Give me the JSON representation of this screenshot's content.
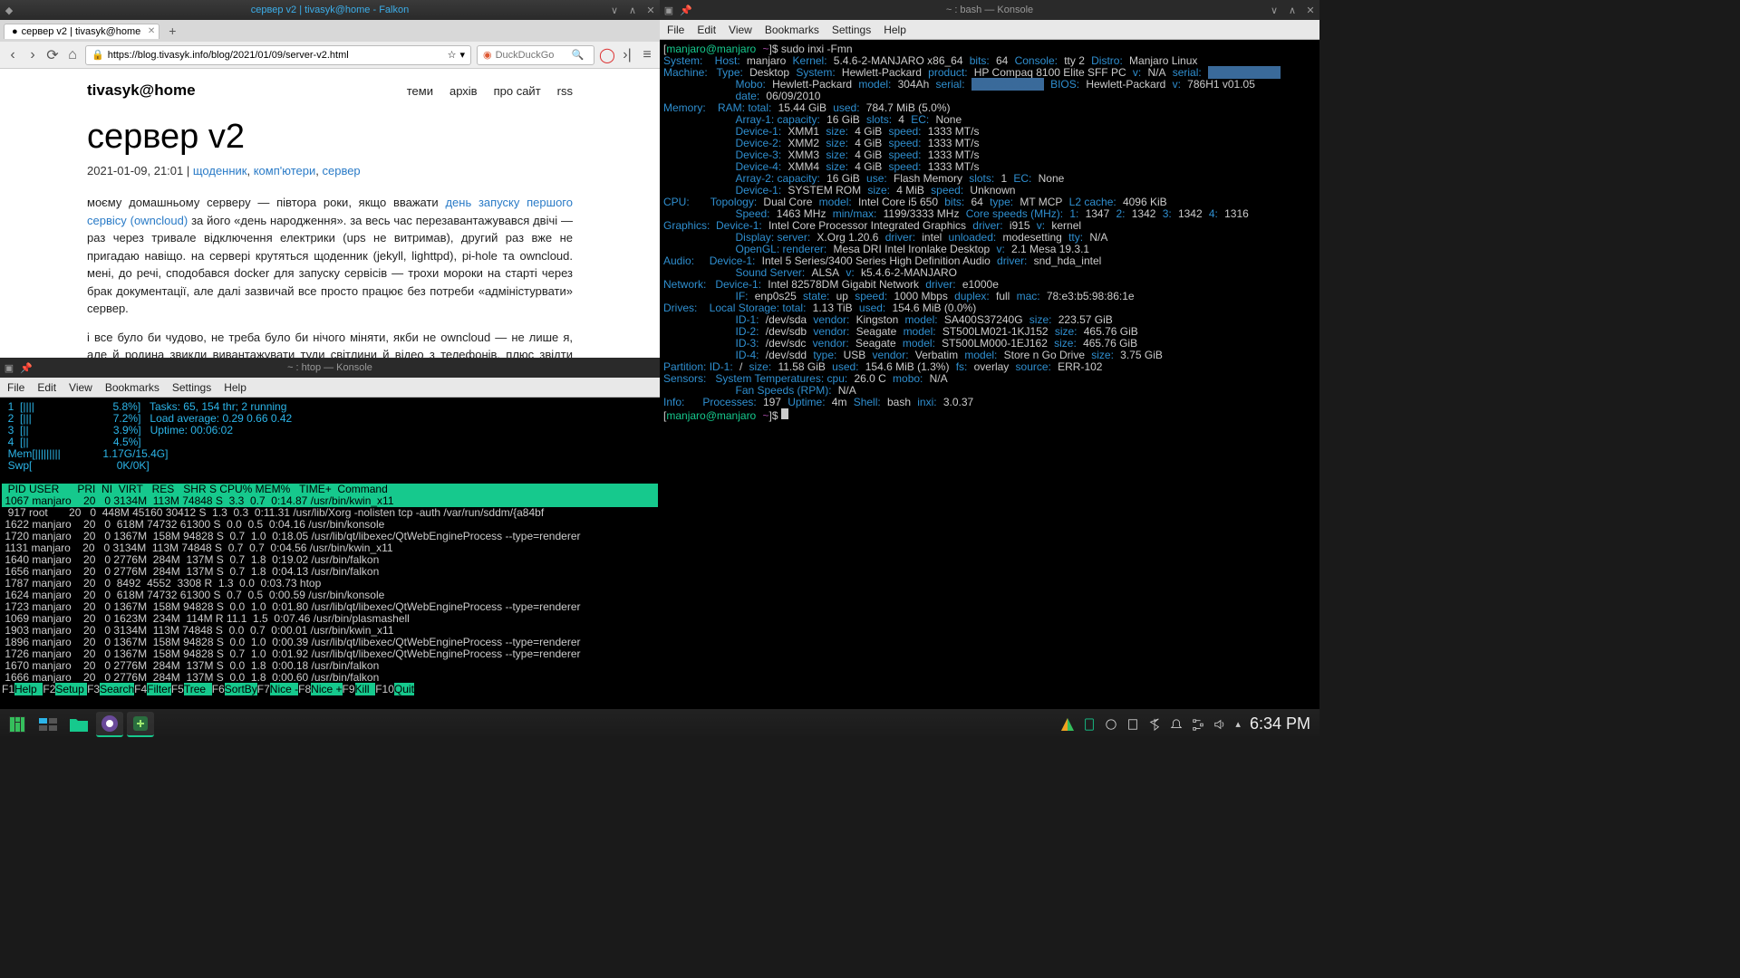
{
  "falkon": {
    "wintitle": "сервер v2 | tivasyk@home - Falkon",
    "tab_title": "сервер v2 | tivasyk@home",
    "url": "https://blog.tivasyk.info/blog/2021/01/09/server-v2.html",
    "search_placeholder": "DuckDuckGo",
    "site_title": "tivasyk@home",
    "nav": {
      "i0": "теми",
      "i1": "архів",
      "i2": "про сайт",
      "i3": "rss"
    },
    "post_title": "сервер v2",
    "post_date": "2021-01-09, 21:01 | ",
    "post_tags": {
      "a": "щоденник",
      "b": "комп'ютери",
      "c": "сервер"
    },
    "p1a": "моєму домашньому серверу — півтора роки, якщо вважати ",
    "p1link": "день запуску першого сервісу (owncloud)",
    "p1b": " за його «день народження». за весь час перезавантажувався двічі — раз через тривале відключення електрики (ups не витримав), другий раз вже не пригадаю навіщо. на сервері крутяться щоденник (jekyll, lighttpd), pi-hole та owncloud. мені, до речі, сподобався docker для запуску сервісів — трохи мороки на старті через брак документації, але далі зазвичай все просто працює без потреби «адміністурвати» сервер.",
    "p2": "і все було би чудово, не треба було би нічого міняти, якби не owncloud — не лише я, але й родина звикли вивантажувати туди світлини й відео з телефонів, плюс звідти роздаються (привезені ще з україни) фільми, по dlna на телевізор… але файлове сховище досі залежить від одного-єдиного диска, без бекапів, і це рецепт маленької катастрофи. плюс хочеться"
  },
  "htop": {
    "wintitle": "~ : htop — Konsole",
    "menu": {
      "file": "File",
      "edit": "Edit",
      "view": "View",
      "bookmarks": "Bookmarks",
      "settings": "Settings",
      "help": "Help"
    },
    "meters": "  1  [||||                          5.8%]   Tasks: 65, 154 thr; 2 running\n  2  [|||                           7.2%]   Load average: 0.29 0.66 0.42\n  3  [||                            3.9%]   Uptime: 00:06:02\n  4  [||                            4.5%]\n  Mem[|||||||||              1.17G/15.4G]\n  Swp[                            0K/0K]",
    "header": "  PID USER      PRI  NI  VIRT   RES   SHR S CPU% MEM%   TIME+  Command",
    "selrow": " 1067 manjaro    20   0 3134M  113M 74848 S  3.3  0.7  0:14.87 /usr/bin/kwin_x11",
    "rows": "  917 root       20   0  448M 45160 30412 S  1.3  0.3  0:11.31 /usr/lib/Xorg -nolisten tcp -auth /var/run/sddm/{a84bf\n 1622 manjaro    20   0  618M 74732 61300 S  0.0  0.5  0:04.16 /usr/bin/konsole\n 1720 manjaro    20   0 1367M  158M 94828 S  0.7  1.0  0:18.05 /usr/lib/qt/libexec/QtWebEngineProcess --type=renderer\n 1131 manjaro    20   0 3134M  113M 74848 S  0.7  0.7  0:04.56 /usr/bin/kwin_x11\n 1640 manjaro    20   0 2776M  284M  137M S  0.7  1.8  0:19.02 /usr/bin/falkon\n 1656 manjaro    20   0 2776M  284M  137M S  0.7  1.8  0:04.13 /usr/bin/falkon\n 1787 manjaro    20   0  8492  4552  3308 R  1.3  0.0  0:03.73 htop\n 1624 manjaro    20   0  618M 74732 61300 S  0.7  0.5  0:00.59 /usr/bin/konsole\n 1723 manjaro    20   0 1367M  158M 94828 S  0.0  1.0  0:01.80 /usr/lib/qt/libexec/QtWebEngineProcess --type=renderer\n 1069 manjaro    20   0 1623M  234M  114M R 11.1  1.5  0:07.46 /usr/bin/plasmashell\n 1903 manjaro    20   0 3134M  113M 74848 S  0.0  0.7  0:00.01 /usr/bin/kwin_x11\n 1896 manjaro    20   0 1367M  158M 94828 S  0.0  1.0  0:00.39 /usr/lib/qt/libexec/QtWebEngineProcess --type=renderer\n 1726 manjaro    20   0 1367M  158M 94828 S  0.7  1.0  0:01.92 /usr/lib/qt/libexec/QtWebEngineProcess --type=renderer\n 1670 manjaro    20   0 2776M  284M  137M S  0.0  1.8  0:00.18 /usr/bin/falkon\n 1666 manjaro    20   0 2776M  284M  137M S  0.0  1.8  0:00.60 /usr/bin/falkon",
    "fkeys": "F1Help  F2Setup F3SearchF4FilterF5Tree  F6SortByF7Nice -F8Nice +F9Kill  F10Quit"
  },
  "inxi": {
    "wintitle": "~ : bash — Konsole",
    "menu": {
      "file": "File",
      "edit": "Edit",
      "view": "View",
      "bookmarks": "Bookmarks",
      "settings": "Settings",
      "help": "Help"
    }
  },
  "taskbar": {
    "clock": "6:34 PM"
  }
}
